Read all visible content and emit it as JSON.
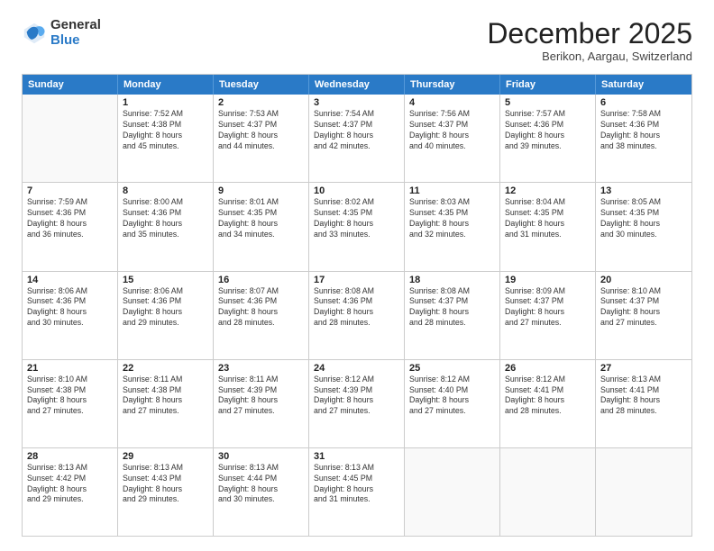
{
  "logo": {
    "general": "General",
    "blue": "Blue"
  },
  "header": {
    "month": "December 2025",
    "location": "Berikon, Aargau, Switzerland"
  },
  "weekdays": [
    "Sunday",
    "Monday",
    "Tuesday",
    "Wednesday",
    "Thursday",
    "Friday",
    "Saturday"
  ],
  "rows": [
    [
      {
        "day": "",
        "info": ""
      },
      {
        "day": "1",
        "info": "Sunrise: 7:52 AM\nSunset: 4:38 PM\nDaylight: 8 hours\nand 45 minutes."
      },
      {
        "day": "2",
        "info": "Sunrise: 7:53 AM\nSunset: 4:37 PM\nDaylight: 8 hours\nand 44 minutes."
      },
      {
        "day": "3",
        "info": "Sunrise: 7:54 AM\nSunset: 4:37 PM\nDaylight: 8 hours\nand 42 minutes."
      },
      {
        "day": "4",
        "info": "Sunrise: 7:56 AM\nSunset: 4:37 PM\nDaylight: 8 hours\nand 40 minutes."
      },
      {
        "day": "5",
        "info": "Sunrise: 7:57 AM\nSunset: 4:36 PM\nDaylight: 8 hours\nand 39 minutes."
      },
      {
        "day": "6",
        "info": "Sunrise: 7:58 AM\nSunset: 4:36 PM\nDaylight: 8 hours\nand 38 minutes."
      }
    ],
    [
      {
        "day": "7",
        "info": "Sunrise: 7:59 AM\nSunset: 4:36 PM\nDaylight: 8 hours\nand 36 minutes."
      },
      {
        "day": "8",
        "info": "Sunrise: 8:00 AM\nSunset: 4:36 PM\nDaylight: 8 hours\nand 35 minutes."
      },
      {
        "day": "9",
        "info": "Sunrise: 8:01 AM\nSunset: 4:35 PM\nDaylight: 8 hours\nand 34 minutes."
      },
      {
        "day": "10",
        "info": "Sunrise: 8:02 AM\nSunset: 4:35 PM\nDaylight: 8 hours\nand 33 minutes."
      },
      {
        "day": "11",
        "info": "Sunrise: 8:03 AM\nSunset: 4:35 PM\nDaylight: 8 hours\nand 32 minutes."
      },
      {
        "day": "12",
        "info": "Sunrise: 8:04 AM\nSunset: 4:35 PM\nDaylight: 8 hours\nand 31 minutes."
      },
      {
        "day": "13",
        "info": "Sunrise: 8:05 AM\nSunset: 4:35 PM\nDaylight: 8 hours\nand 30 minutes."
      }
    ],
    [
      {
        "day": "14",
        "info": "Sunrise: 8:06 AM\nSunset: 4:36 PM\nDaylight: 8 hours\nand 30 minutes."
      },
      {
        "day": "15",
        "info": "Sunrise: 8:06 AM\nSunset: 4:36 PM\nDaylight: 8 hours\nand 29 minutes."
      },
      {
        "day": "16",
        "info": "Sunrise: 8:07 AM\nSunset: 4:36 PM\nDaylight: 8 hours\nand 28 minutes."
      },
      {
        "day": "17",
        "info": "Sunrise: 8:08 AM\nSunset: 4:36 PM\nDaylight: 8 hours\nand 28 minutes."
      },
      {
        "day": "18",
        "info": "Sunrise: 8:08 AM\nSunset: 4:37 PM\nDaylight: 8 hours\nand 28 minutes."
      },
      {
        "day": "19",
        "info": "Sunrise: 8:09 AM\nSunset: 4:37 PM\nDaylight: 8 hours\nand 27 minutes."
      },
      {
        "day": "20",
        "info": "Sunrise: 8:10 AM\nSunset: 4:37 PM\nDaylight: 8 hours\nand 27 minutes."
      }
    ],
    [
      {
        "day": "21",
        "info": "Sunrise: 8:10 AM\nSunset: 4:38 PM\nDaylight: 8 hours\nand 27 minutes."
      },
      {
        "day": "22",
        "info": "Sunrise: 8:11 AM\nSunset: 4:38 PM\nDaylight: 8 hours\nand 27 minutes."
      },
      {
        "day": "23",
        "info": "Sunrise: 8:11 AM\nSunset: 4:39 PM\nDaylight: 8 hours\nand 27 minutes."
      },
      {
        "day": "24",
        "info": "Sunrise: 8:12 AM\nSunset: 4:39 PM\nDaylight: 8 hours\nand 27 minutes."
      },
      {
        "day": "25",
        "info": "Sunrise: 8:12 AM\nSunset: 4:40 PM\nDaylight: 8 hours\nand 27 minutes."
      },
      {
        "day": "26",
        "info": "Sunrise: 8:12 AM\nSunset: 4:41 PM\nDaylight: 8 hours\nand 28 minutes."
      },
      {
        "day": "27",
        "info": "Sunrise: 8:13 AM\nSunset: 4:41 PM\nDaylight: 8 hours\nand 28 minutes."
      }
    ],
    [
      {
        "day": "28",
        "info": "Sunrise: 8:13 AM\nSunset: 4:42 PM\nDaylight: 8 hours\nand 29 minutes."
      },
      {
        "day": "29",
        "info": "Sunrise: 8:13 AM\nSunset: 4:43 PM\nDaylight: 8 hours\nand 29 minutes."
      },
      {
        "day": "30",
        "info": "Sunrise: 8:13 AM\nSunset: 4:44 PM\nDaylight: 8 hours\nand 30 minutes."
      },
      {
        "day": "31",
        "info": "Sunrise: 8:13 AM\nSunset: 4:45 PM\nDaylight: 8 hours\nand 31 minutes."
      },
      {
        "day": "",
        "info": ""
      },
      {
        "day": "",
        "info": ""
      },
      {
        "day": "",
        "info": ""
      }
    ]
  ]
}
